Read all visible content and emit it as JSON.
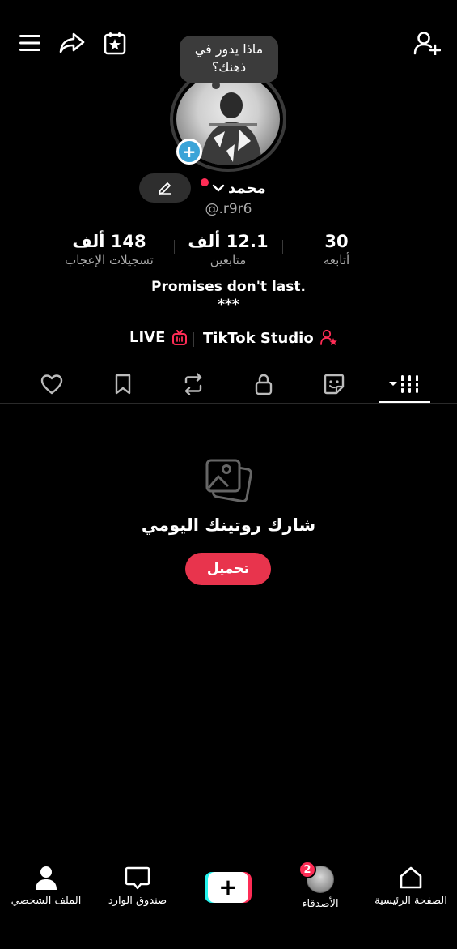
{
  "header": {
    "menu_icon": "hamburger-menu-icon",
    "share_icon": "share-arrow-icon",
    "calendar_icon": "calendar-star-icon",
    "add_friend_icon": "add-user-icon"
  },
  "profile": {
    "bubble_text": "ماذا يدور في ذهنك؟",
    "name": "محمد",
    "handle": "@.r9r6",
    "stats": [
      {
        "value": "148 ألف",
        "label": "تسجيلات الإعجاب"
      },
      {
        "value": "12.1 ألف",
        "label": "متابعين"
      },
      {
        "value": "30",
        "label": "أتابعه"
      }
    ],
    "bio_line1": "Promises don't last.",
    "bio_line2": "***",
    "links": {
      "live": "LIVE",
      "studio": "TikTok Studio"
    }
  },
  "tabs": [
    {
      "icon": "heart-icon"
    },
    {
      "icon": "bookmark-icon"
    },
    {
      "icon": "repost-icon"
    },
    {
      "icon": "lock-icon"
    },
    {
      "icon": "sticker-icon"
    },
    {
      "icon": "grid-icon",
      "active": true
    }
  ],
  "empty_state": {
    "icon": "photos-icon",
    "title": "شارك روتينك اليومي",
    "button": "تحميل"
  },
  "bottom_nav": {
    "profile": "الملف الشخصي",
    "inbox": "صندوق الوارد",
    "friends": "الأصدقاء",
    "friends_badge": "2",
    "home": "الصفحة الرئيسية"
  },
  "colors": {
    "accent": "#fe2c55",
    "avatar_plus": "#3aa4d8",
    "background": "#000000"
  }
}
